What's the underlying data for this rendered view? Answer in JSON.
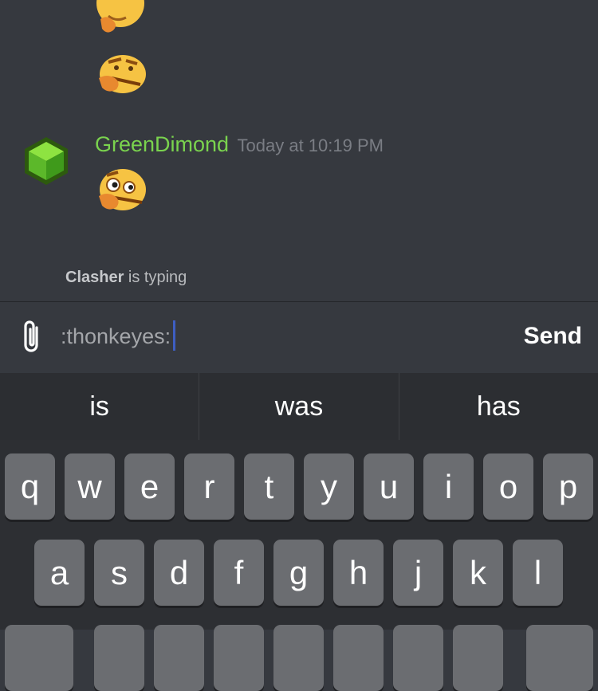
{
  "chat": {
    "message": {
      "username": "GreenDimond",
      "timestamp": "Today at 10:19 PM"
    },
    "typing_indicator": {
      "user": "Clasher",
      "text": " is typing"
    },
    "emojis": [
      "thonk-emoji",
      "thonk-emoji",
      "thonkeyes-emoji"
    ]
  },
  "composer": {
    "input_value": ":thonkeyes:",
    "send_label": "Send"
  },
  "suggestions": [
    "is",
    "was",
    "has"
  ],
  "keyboard": {
    "row1": [
      "q",
      "w",
      "e",
      "r",
      "t",
      "y",
      "u",
      "i",
      "o",
      "p"
    ],
    "row2": [
      "a",
      "s",
      "d",
      "f",
      "g",
      "h",
      "j",
      "k",
      "l"
    ]
  },
  "colors": {
    "username": "#7ad34e",
    "background": "#36393f",
    "caret": "#3e5ec2",
    "keyboard_bg": "#2d2f33",
    "key_bg": "#6b6d71"
  },
  "icons": {
    "avatar": "green-cube-avatar",
    "attach": "paperclip-icon"
  }
}
